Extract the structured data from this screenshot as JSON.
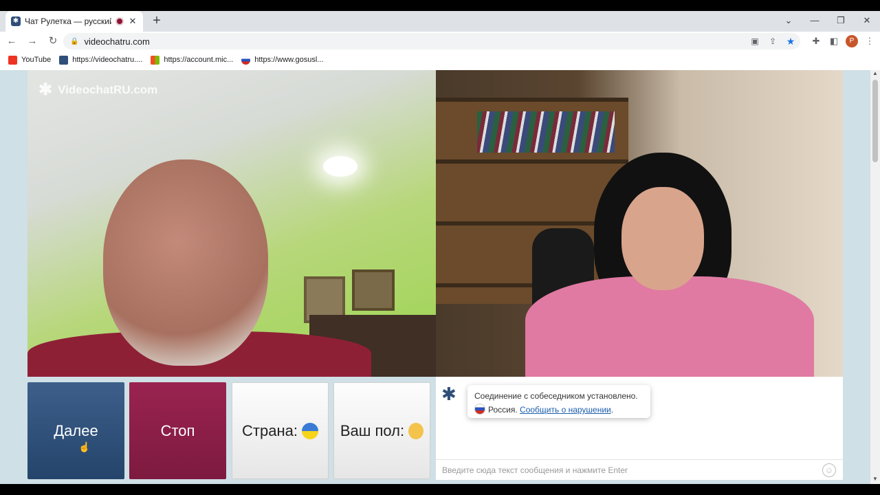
{
  "browser": {
    "tab_title": "Чат Рулетка — русский вид",
    "url": "videochatru.com",
    "avatar_letter": "P",
    "bookmarks": [
      "YouTube",
      "https://videochatru....",
      "https://account.mic...",
      "https://www.gosusl..."
    ]
  },
  "video": {
    "watermark": "VideochatRU.com"
  },
  "controls": {
    "next_label": "Далее",
    "stop_label": "Стоп",
    "country_label": "Страна:",
    "gender_label": "Ваш пол:"
  },
  "chat": {
    "connected_msg": "Соединение с собеседником установлено.",
    "country": "Россия.",
    "report_link": "Сообщить о нарушении",
    "report_suffix": ".",
    "input_placeholder": "Введите сюда текст сообщения и нажмите Enter"
  },
  "colors": {
    "next": "#2f4f7a",
    "stop": "#8c1d46",
    "page_bg": "#cfe0e6"
  }
}
